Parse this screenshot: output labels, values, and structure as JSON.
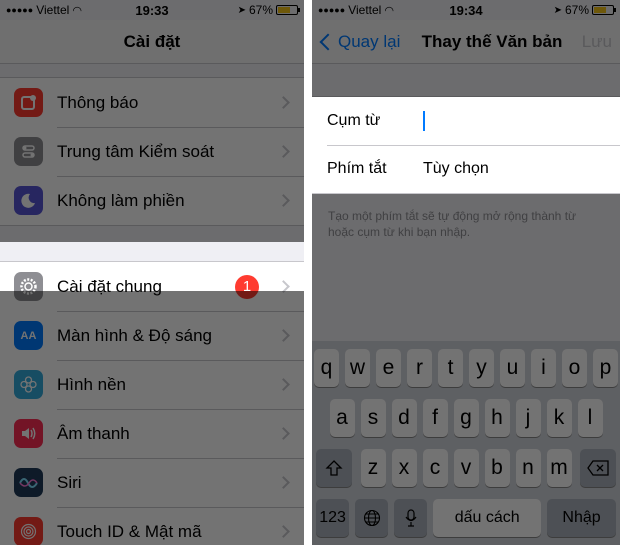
{
  "left": {
    "status": {
      "carrier": "Viettel",
      "time": "19:33",
      "battery": "67%",
      "battery_level": 0.67
    },
    "title": "Cài đặt",
    "group1": [
      {
        "label": "Thông báo",
        "icon": "notifications-icon",
        "color": "#ff3b30"
      },
      {
        "label": "Trung tâm Kiểm soát",
        "icon": "control-center-icon",
        "color": "#8e8e93"
      },
      {
        "label": "Không làm phiền",
        "icon": "moon-icon",
        "color": "#5856d6"
      }
    ],
    "group2": [
      {
        "label": "Cài đặt chung",
        "icon": "gear-icon",
        "color": "#8e8e93",
        "badge": "1"
      },
      {
        "label": "Màn hình & Độ sáng",
        "icon": "display-icon",
        "color": "#007aff",
        "icon_text": "AA"
      },
      {
        "label": "Hình nền",
        "icon": "wallpaper-icon",
        "color": "#34aadc"
      },
      {
        "label": "Âm thanh",
        "icon": "sound-icon",
        "color": "#ff2d55"
      },
      {
        "label": "Siri",
        "icon": "siri-icon",
        "color": "#1f3a5a"
      },
      {
        "label": "Touch ID & Mật mã",
        "icon": "fingerprint-icon",
        "color": "#ff3b30"
      }
    ]
  },
  "right": {
    "status": {
      "carrier": "Viettel",
      "time": "19:34",
      "battery": "67%",
      "battery_level": 0.67
    },
    "back_label": "Quay lại",
    "title": "Thay thế Văn bản",
    "save_label": "Lưu",
    "phrase_label": "Cụm từ",
    "shortcut_label": "Phím tắt",
    "shortcut_placeholder": "Tùy chọn",
    "hint": "Tạo một phím tắt sẽ tự động mở rộng thành từ hoặc cụm từ khi bạn nhập.",
    "keyboard": {
      "row1": [
        "q",
        "w",
        "e",
        "r",
        "t",
        "y",
        "u",
        "i",
        "o",
        "p"
      ],
      "row2": [
        "a",
        "s",
        "d",
        "f",
        "g",
        "h",
        "j",
        "k",
        "l"
      ],
      "row3": [
        "z",
        "x",
        "c",
        "v",
        "b",
        "n",
        "m"
      ],
      "numbers_label": "123",
      "space_label": "dấu cách",
      "return_label": "Nhập"
    }
  }
}
